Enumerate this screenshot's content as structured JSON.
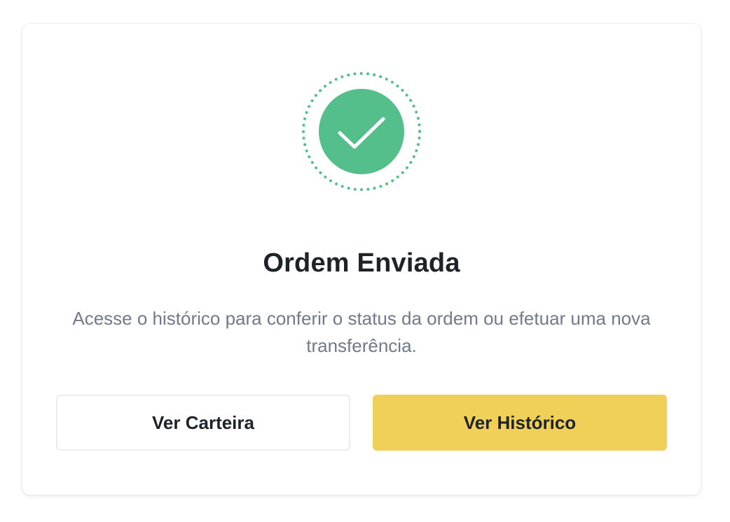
{
  "dialog": {
    "status_icon": "check-circle-icon",
    "title": "Ordem Enviada",
    "description": "Acesse o histórico para conferir o status da ordem ou efetuar uma nova transferência.",
    "secondary_button_label": "Ver Carteira",
    "primary_button_label": "Ver Histórico"
  },
  "colors": {
    "success": "#54bf8b",
    "primary_button": "#f0d058",
    "title_text": "#1e2329",
    "body_text": "#707a8a",
    "border": "#eaecef"
  }
}
